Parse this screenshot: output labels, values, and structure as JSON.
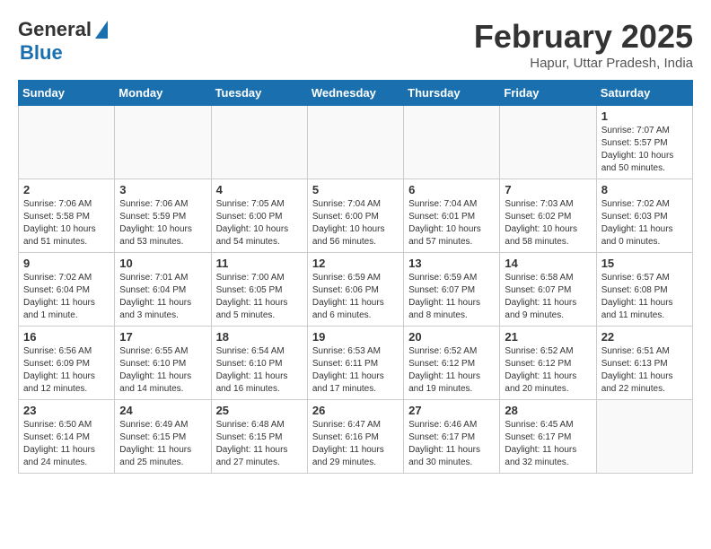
{
  "header": {
    "logo_general": "General",
    "logo_blue": "Blue",
    "month_title": "February 2025",
    "location": "Hapur, Uttar Pradesh, India"
  },
  "weekdays": [
    "Sunday",
    "Monday",
    "Tuesday",
    "Wednesday",
    "Thursday",
    "Friday",
    "Saturday"
  ],
  "weeks": [
    [
      {
        "day": "",
        "info": ""
      },
      {
        "day": "",
        "info": ""
      },
      {
        "day": "",
        "info": ""
      },
      {
        "day": "",
        "info": ""
      },
      {
        "day": "",
        "info": ""
      },
      {
        "day": "",
        "info": ""
      },
      {
        "day": "1",
        "info": "Sunrise: 7:07 AM\nSunset: 5:57 PM\nDaylight: 10 hours and 50 minutes."
      }
    ],
    [
      {
        "day": "2",
        "info": "Sunrise: 7:06 AM\nSunset: 5:58 PM\nDaylight: 10 hours and 51 minutes."
      },
      {
        "day": "3",
        "info": "Sunrise: 7:06 AM\nSunset: 5:59 PM\nDaylight: 10 hours and 53 minutes."
      },
      {
        "day": "4",
        "info": "Sunrise: 7:05 AM\nSunset: 6:00 PM\nDaylight: 10 hours and 54 minutes."
      },
      {
        "day": "5",
        "info": "Sunrise: 7:04 AM\nSunset: 6:00 PM\nDaylight: 10 hours and 56 minutes."
      },
      {
        "day": "6",
        "info": "Sunrise: 7:04 AM\nSunset: 6:01 PM\nDaylight: 10 hours and 57 minutes."
      },
      {
        "day": "7",
        "info": "Sunrise: 7:03 AM\nSunset: 6:02 PM\nDaylight: 10 hours and 58 minutes."
      },
      {
        "day": "8",
        "info": "Sunrise: 7:02 AM\nSunset: 6:03 PM\nDaylight: 11 hours and 0 minutes."
      }
    ],
    [
      {
        "day": "9",
        "info": "Sunrise: 7:02 AM\nSunset: 6:04 PM\nDaylight: 11 hours and 1 minute."
      },
      {
        "day": "10",
        "info": "Sunrise: 7:01 AM\nSunset: 6:04 PM\nDaylight: 11 hours and 3 minutes."
      },
      {
        "day": "11",
        "info": "Sunrise: 7:00 AM\nSunset: 6:05 PM\nDaylight: 11 hours and 5 minutes."
      },
      {
        "day": "12",
        "info": "Sunrise: 6:59 AM\nSunset: 6:06 PM\nDaylight: 11 hours and 6 minutes."
      },
      {
        "day": "13",
        "info": "Sunrise: 6:59 AM\nSunset: 6:07 PM\nDaylight: 11 hours and 8 minutes."
      },
      {
        "day": "14",
        "info": "Sunrise: 6:58 AM\nSunset: 6:07 PM\nDaylight: 11 hours and 9 minutes."
      },
      {
        "day": "15",
        "info": "Sunrise: 6:57 AM\nSunset: 6:08 PM\nDaylight: 11 hours and 11 minutes."
      }
    ],
    [
      {
        "day": "16",
        "info": "Sunrise: 6:56 AM\nSunset: 6:09 PM\nDaylight: 11 hours and 12 minutes."
      },
      {
        "day": "17",
        "info": "Sunrise: 6:55 AM\nSunset: 6:10 PM\nDaylight: 11 hours and 14 minutes."
      },
      {
        "day": "18",
        "info": "Sunrise: 6:54 AM\nSunset: 6:10 PM\nDaylight: 11 hours and 16 minutes."
      },
      {
        "day": "19",
        "info": "Sunrise: 6:53 AM\nSunset: 6:11 PM\nDaylight: 11 hours and 17 minutes."
      },
      {
        "day": "20",
        "info": "Sunrise: 6:52 AM\nSunset: 6:12 PM\nDaylight: 11 hours and 19 minutes."
      },
      {
        "day": "21",
        "info": "Sunrise: 6:52 AM\nSunset: 6:12 PM\nDaylight: 11 hours and 20 minutes."
      },
      {
        "day": "22",
        "info": "Sunrise: 6:51 AM\nSunset: 6:13 PM\nDaylight: 11 hours and 22 minutes."
      }
    ],
    [
      {
        "day": "23",
        "info": "Sunrise: 6:50 AM\nSunset: 6:14 PM\nDaylight: 11 hours and 24 minutes."
      },
      {
        "day": "24",
        "info": "Sunrise: 6:49 AM\nSunset: 6:15 PM\nDaylight: 11 hours and 25 minutes."
      },
      {
        "day": "25",
        "info": "Sunrise: 6:48 AM\nSunset: 6:15 PM\nDaylight: 11 hours and 27 minutes."
      },
      {
        "day": "26",
        "info": "Sunrise: 6:47 AM\nSunset: 6:16 PM\nDaylight: 11 hours and 29 minutes."
      },
      {
        "day": "27",
        "info": "Sunrise: 6:46 AM\nSunset: 6:17 PM\nDaylight: 11 hours and 30 minutes."
      },
      {
        "day": "28",
        "info": "Sunrise: 6:45 AM\nSunset: 6:17 PM\nDaylight: 11 hours and 32 minutes."
      },
      {
        "day": "",
        "info": ""
      }
    ]
  ]
}
